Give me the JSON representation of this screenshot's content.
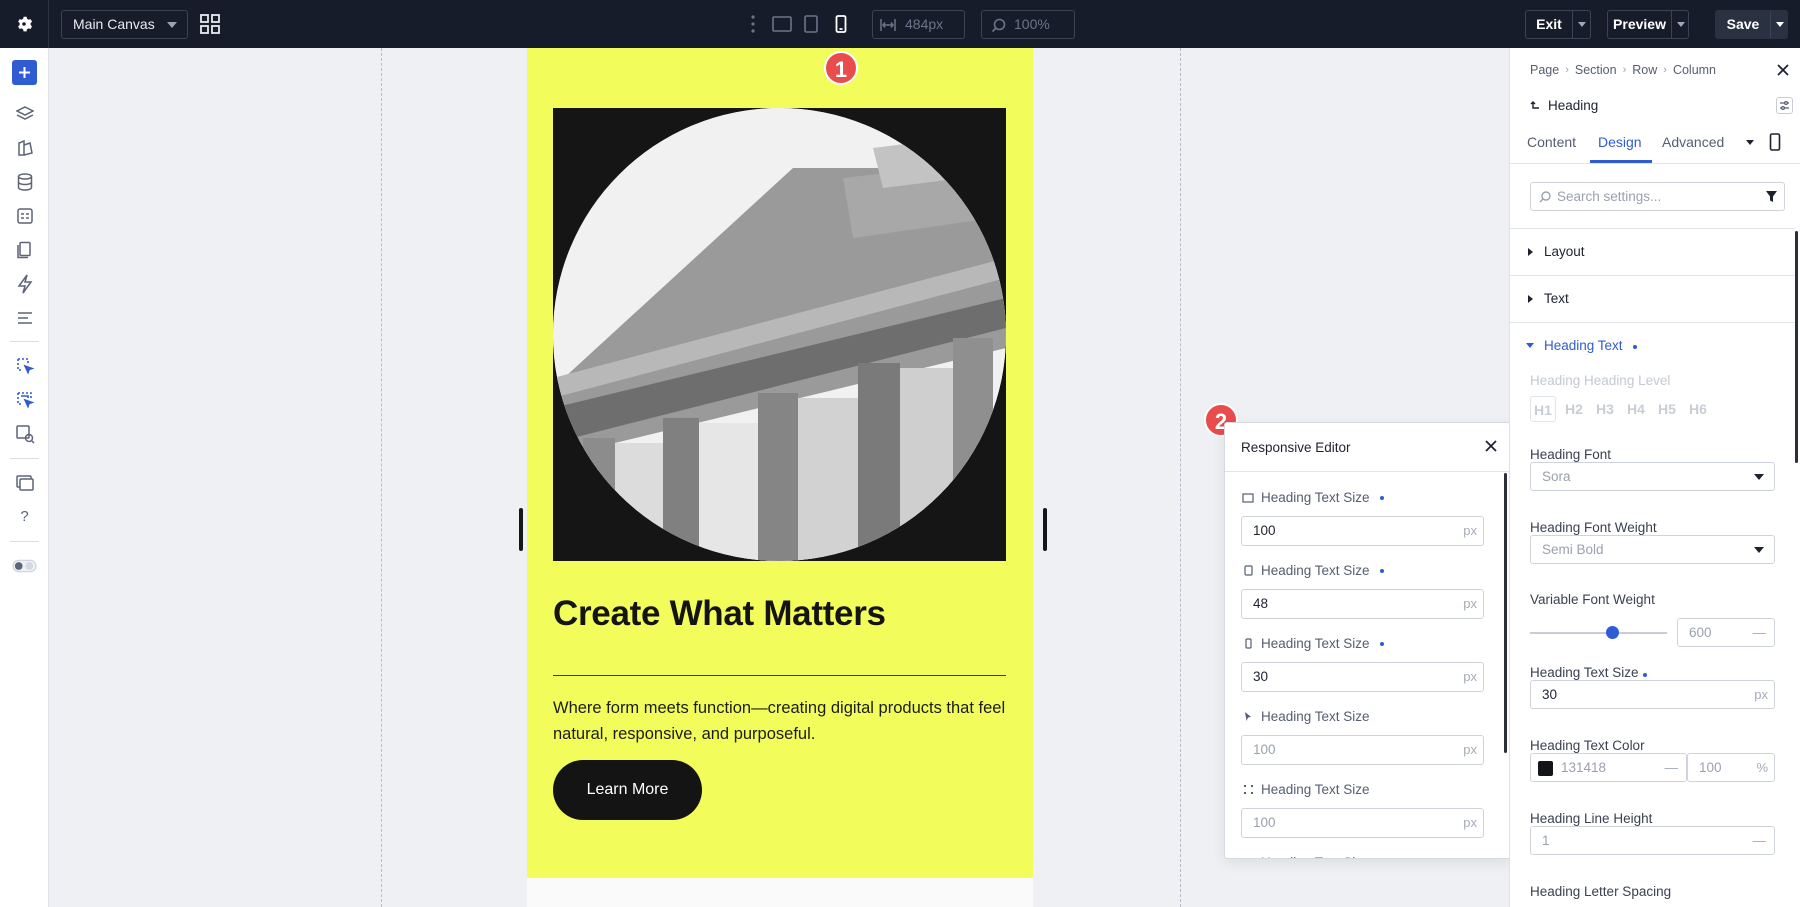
{
  "topbar": {
    "canvas_select": "Main Canvas",
    "width_value": "484px",
    "zoom_value": "100%",
    "exit_label": "Exit",
    "preview_label": "Preview",
    "save_label": "Save"
  },
  "preview": {
    "title": "Create What Matters",
    "body": "Where form meets function—creating digital products that feel natural, responsive, and purposeful.",
    "button": "Learn More"
  },
  "markers": {
    "one": "1",
    "two": "2"
  },
  "responsive_editor": {
    "title": "Responsive Editor",
    "rows": [
      {
        "label": "Heading Text Size",
        "value": "100",
        "placeholder": "",
        "unit": "px",
        "modified": true,
        "device": "desktop-icon"
      },
      {
        "label": "Heading Text Size",
        "value": "48",
        "placeholder": "",
        "unit": "px",
        "modified": true,
        "device": "tablet-icon"
      },
      {
        "label": "Heading Text Size",
        "value": "30",
        "placeholder": "",
        "unit": "px",
        "modified": true,
        "device": "phone-icon"
      },
      {
        "label": "Heading Text Size",
        "value": "",
        "placeholder": "100",
        "unit": "px",
        "modified": false,
        "device": "hover-icon"
      },
      {
        "label": "Heading Text Size",
        "value": "",
        "placeholder": "100",
        "unit": "px",
        "modified": false,
        "device": "sticky-icon"
      },
      {
        "label": "Heading Text Size",
        "value": "",
        "placeholder": "",
        "unit": "",
        "modified": false,
        "device": "desktop-icon"
      }
    ]
  },
  "panel": {
    "breadcrumbs": [
      "Page",
      "Section",
      "Row",
      "Column"
    ],
    "element_name": "Heading",
    "tabs": [
      "Content",
      "Design",
      "Advanced"
    ],
    "active_tab": "Design",
    "search_placeholder": "Search settings...",
    "sections": {
      "layout": "Layout",
      "text": "Text",
      "heading_text": "Heading Text"
    },
    "heading_level_label": "Heading Heading Level",
    "heading_levels": [
      "H1",
      "H2",
      "H3",
      "H4",
      "H5",
      "H6"
    ],
    "heading_font_label": "Heading Font",
    "heading_font_value": "Sora",
    "heading_weight_label": "Heading Font Weight",
    "heading_weight_value": "Semi Bold",
    "variable_weight_label": "Variable Font Weight",
    "variable_weight_value": "600",
    "variable_weight_fraction": 0.6,
    "text_size_label": "Heading Text Size",
    "text_size_value": "30",
    "text_size_unit": "px",
    "text_color_label": "Heading Text Color",
    "text_color_hex": "131418",
    "text_color_opacity": "100",
    "text_color_opacity_unit": "%",
    "line_height_label": "Heading Line Height",
    "line_height_value": "1",
    "letter_spacing_label": "Heading Letter Spacing"
  },
  "colors": {
    "accent": "#2f5bd3",
    "preview_bg": "#f2fd5c",
    "badge": "#e84c4c",
    "topbar": "#161c29"
  }
}
